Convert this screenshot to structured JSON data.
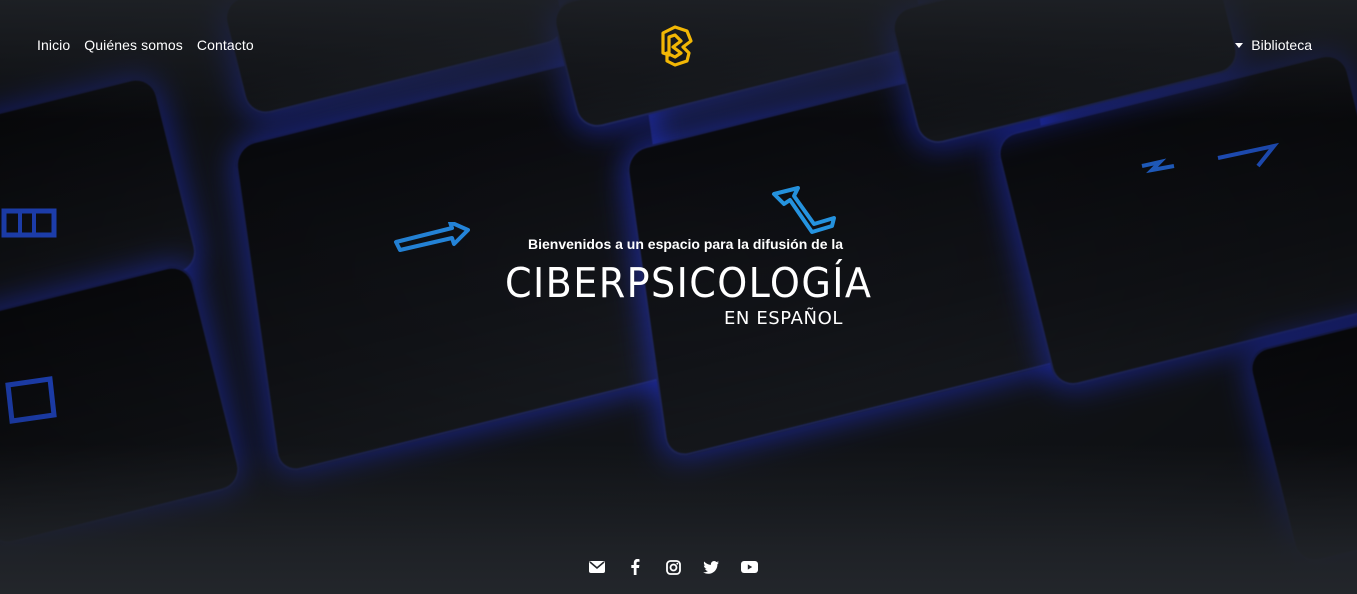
{
  "nav": {
    "items": [
      {
        "label": "Inicio"
      },
      {
        "label": "Quiénes somos"
      },
      {
        "label": "Contacto"
      }
    ]
  },
  "logo": {
    "icon": "cp-logo-icon",
    "color": "#f2b705"
  },
  "library_menu": {
    "label": "Biblioteca",
    "icon": "caret-down-icon"
  },
  "hero": {
    "welcome": "Bienvenidos a un espacio para la difusión de la",
    "title": "CIBERPSICOLOGÍA",
    "subtitle": "EN ESPAÑOL"
  },
  "social": [
    {
      "icon": "envelope-icon"
    },
    {
      "icon": "facebook-icon"
    },
    {
      "icon": "instagram-icon"
    },
    {
      "icon": "twitter-icon"
    },
    {
      "icon": "youtube-icon"
    }
  ],
  "colors": {
    "accent": "#f2b705",
    "key_glow": "#3340ff",
    "background": "#23262b"
  }
}
